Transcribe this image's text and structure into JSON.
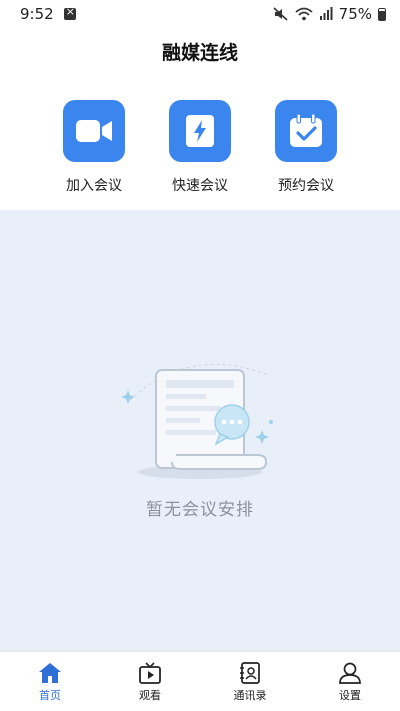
{
  "status_bar": {
    "time": "9:52",
    "battery": "75%"
  },
  "header": {
    "title": "融媒连线"
  },
  "actions": [
    {
      "label": "加入会议",
      "icon": "video-camera-icon"
    },
    {
      "label": "快速会议",
      "icon": "lightning-icon"
    },
    {
      "label": "预约会议",
      "icon": "calendar-check-icon"
    }
  ],
  "empty_state": {
    "message": "暂无会议安排",
    "icon": "document-chat-illustration"
  },
  "tab_bar": {
    "active_color": "#2f6fd6",
    "items": [
      {
        "label": "首页",
        "icon": "home-icon",
        "active": true
      },
      {
        "label": "观看",
        "icon": "tv-play-icon",
        "active": false
      },
      {
        "label": "通讯录",
        "icon": "contacts-book-icon",
        "active": false
      },
      {
        "label": "设置",
        "icon": "user-icon",
        "active": false
      }
    ]
  },
  "colors": {
    "accent": "#3b86ee",
    "content_bg": "#e9eff8"
  }
}
